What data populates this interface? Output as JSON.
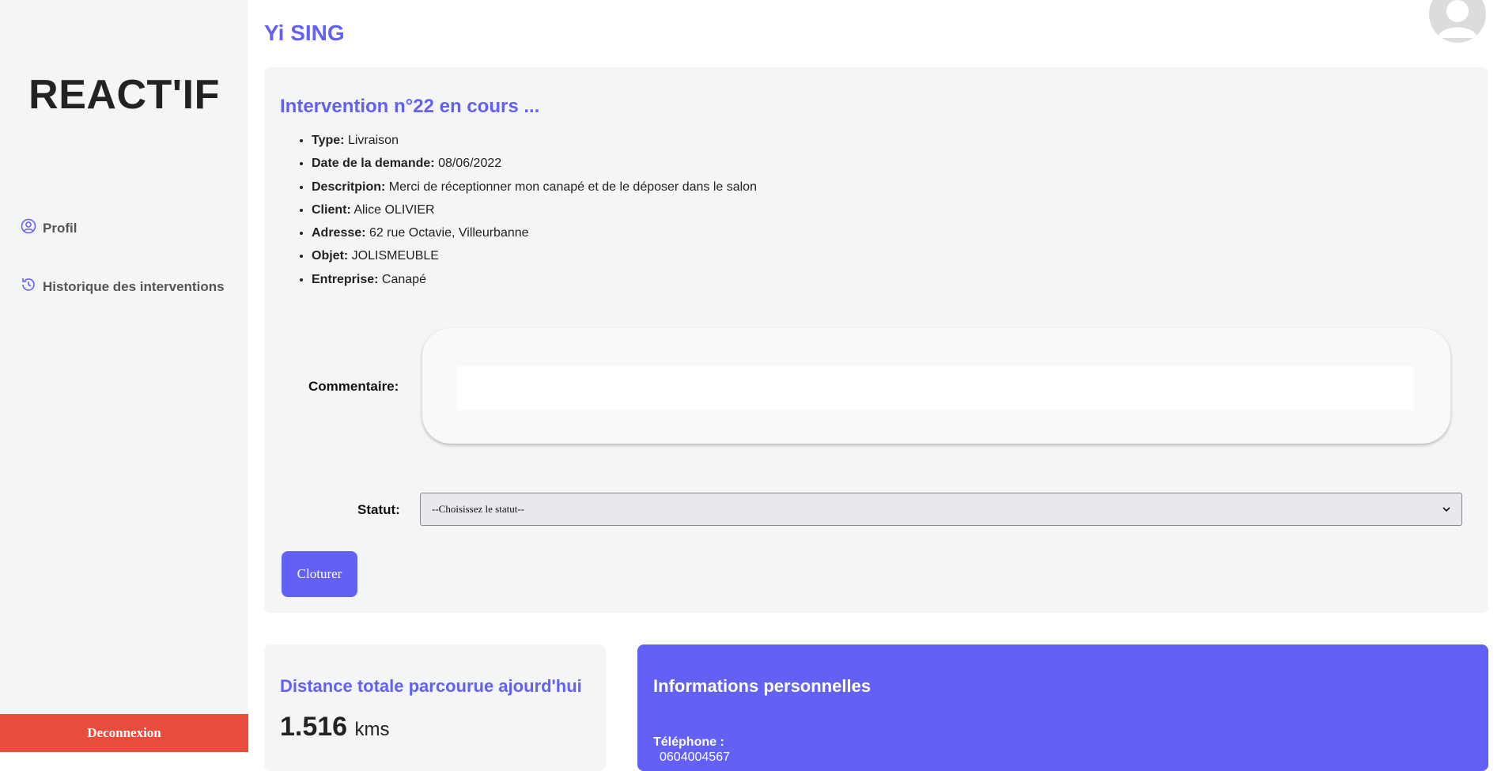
{
  "app": {
    "logo": "REACT'IF"
  },
  "sidebar": {
    "items": [
      {
        "label": "Profil",
        "icon": "user-circle-icon"
      },
      {
        "label": "Historique des interventions",
        "icon": "history-icon"
      }
    ],
    "logout_label": "Deconnexion"
  },
  "header": {
    "user_name": "Yi SING"
  },
  "intervention": {
    "title": "Intervention n°22 en cours ...",
    "fields": [
      {
        "label": "Type:",
        "value": "Livraison"
      },
      {
        "label": "Date de la demande:",
        "value": "08/06/2022"
      },
      {
        "label": "Descritpion:",
        "value": "Merci de réceptionner mon canapé et de le déposer dans le salon"
      },
      {
        "label": "Client:",
        "value": "Alice OLIVIER"
      },
      {
        "label": "Adresse:",
        "value": "62 rue Octavie, Villeurbanne"
      },
      {
        "label": "Objet:",
        "value": "JOLISMEUBLE"
      },
      {
        "label": "Entreprise:",
        "value": "Canapé"
      }
    ],
    "comment_label": "Commentaire:",
    "comment_value": "",
    "status_label": "Statut:",
    "status_selected": "--Choisissez le statut--",
    "close_button": "Cloturer"
  },
  "distance": {
    "title": "Distance totale parcourue ajourd'hui",
    "value": "1.516",
    "unit": "kms"
  },
  "personal_info": {
    "title": "Informations personnelles",
    "phone_label": "Téléphone :",
    "phone_value": "0604004567"
  },
  "colors": {
    "accent": "#6361f5",
    "danger": "#e74c3c",
    "panel": "#f4f5f7"
  }
}
